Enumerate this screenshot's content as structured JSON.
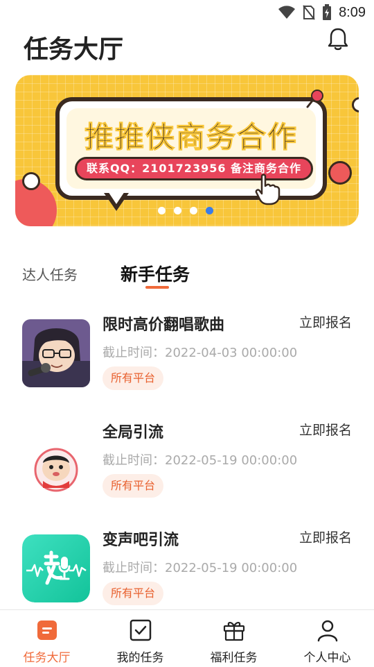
{
  "status_bar": {
    "time": "8:09"
  },
  "header": {
    "title": "任务大厅"
  },
  "banner": {
    "headline": "推推侠商务合作",
    "contact": "联系QQ：2101723956 备注商务合作",
    "dot_count": 4,
    "active_dot": 3
  },
  "tabs": {
    "expert": "达人任务",
    "newbie": "新手任务"
  },
  "tasks": [
    {
      "title": "限时高价翻唱歌曲",
      "signup": "立即报名",
      "deadline": "截止时间：2022-04-03 00:00:00",
      "platform": "所有平台",
      "thumb": "anime-character-mic"
    },
    {
      "title": "全局引流",
      "signup": "立即报名",
      "deadline": "截止时间：2022-05-19 00:00:00",
      "platform": "所有平台",
      "thumb": "cartoon-boy-avatar"
    },
    {
      "title": "变声吧引流",
      "signup": "立即报名",
      "deadline": "截止时间：2022-05-19 00:00:00",
      "platform": "所有平台",
      "thumb": "voice-changer-app-logo"
    }
  ],
  "bottom_nav": [
    {
      "label": "任务大厅",
      "icon": "task-hall-icon",
      "active": true
    },
    {
      "label": "我的任务",
      "icon": "checkbox-icon",
      "active": false
    },
    {
      "label": "福利任务",
      "icon": "gift-icon",
      "active": false
    },
    {
      "label": "个人中心",
      "icon": "person-icon",
      "active": false
    }
  ],
  "colors": {
    "accent": "#f06a3a",
    "banner_bg": "#f8c63a",
    "badge_bg": "#fdeee7",
    "active_dot": "#3a7ce8"
  }
}
